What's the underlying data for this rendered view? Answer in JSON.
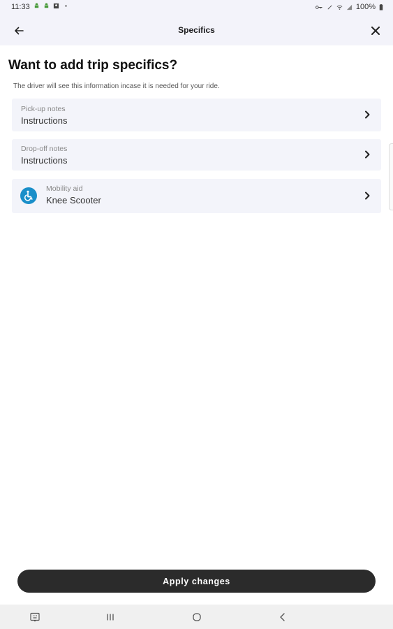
{
  "status_bar": {
    "time": "11:33",
    "battery": "100%"
  },
  "header": {
    "title": "Specifics"
  },
  "main": {
    "title": "Want to add trip specifics?",
    "subtitle": "The driver will see this information incase it is needed for your ride.",
    "cards": [
      {
        "label": "Pick-up notes",
        "value": "Instructions"
      },
      {
        "label": "Drop-off notes",
        "value": "Instructions"
      },
      {
        "label": "Mobility aid",
        "value": "Knee Scooter",
        "icon": "wheelchair-icon"
      }
    ]
  },
  "footer": {
    "apply_label": "Apply changes"
  },
  "colors": {
    "accent": "#1a8fc9",
    "button": "#2b2b2b",
    "card_bg": "#f3f4fa",
    "header_bg": "#f3f3fa"
  }
}
